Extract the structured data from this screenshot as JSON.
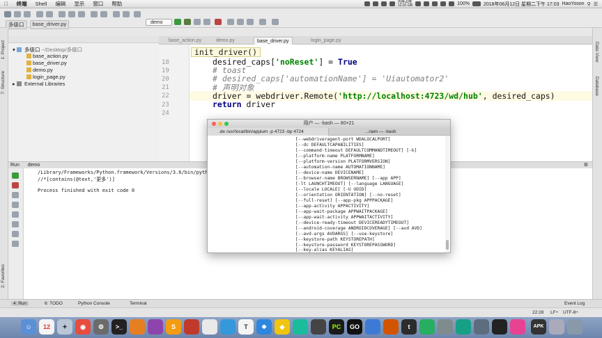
{
  "menubar": {
    "app": "终端",
    "items": [
      "Shell",
      "编辑",
      "显示",
      "窗口",
      "帮助"
    ],
    "status": {
      "memory_line1": "内存占用",
      "memory_line2": "12.01 GB",
      "battery": "100%",
      "datetime": "2018年06月12日 星期二下午 17:03",
      "user": "HaoYoson"
    }
  },
  "ide": {
    "breadcrumb": [
      "多级口",
      "base_driver.py"
    ],
    "run_config": "demo",
    "project_panel": {
      "root": "多级口",
      "root_path": "~/Desktop/多级口",
      "files": [
        "base_action.py",
        "base_driver.py",
        "demo.py",
        "login_page.py"
      ],
      "external": "External Libraries"
    },
    "tabs": [
      "base_action.py",
      "demo.py",
      "base_driver.py",
      "login_page.py"
    ],
    "active_tab": "base_driver.py",
    "function_chip": "init_driver()",
    "line_numbers": [
      "18",
      "19",
      "20",
      "21",
      "22",
      "23",
      "24"
    ],
    "code": {
      "line18_a": "desired_caps[",
      "line18_b": "'noReset'",
      "line18_c": "] = ",
      "line18_d": "True",
      "line19": "# toast",
      "line20": "# desired_caps['automationName'] = 'Uiautomator2'",
      "line21": "# 声明对象",
      "line22_a": "driver = webdriver.Remote(",
      "line22_b": "'http://localhost:4723/wd/hub'",
      "line22_c": ", desired_caps)",
      "line23_a": "return",
      "line23_b": " driver"
    },
    "run_panel": {
      "label_run": "Run",
      "label_cfg": "demo",
      "output_line1": "/Library/Frameworks/Python.framework/Versions/3.6/bin/pyth",
      "output_line2": "//*[contains(@text,'更多')]",
      "output_line3": "Process finished with exit code 0"
    },
    "left_strip": {
      "project": "1: Project",
      "structure": "7: Structure",
      "favorites": "2: Favorites"
    },
    "right_strip": {
      "view": "Data View",
      "database": "Database"
    },
    "bottom_tabs": [
      "4: Run",
      "6: TODO",
      "Python Console",
      "Terminal"
    ],
    "event_log": "Event Log",
    "status": {
      "position": "22:28",
      "line_sep": "LF÷",
      "encoding": "UTF-8÷"
    }
  },
  "terminal": {
    "title": "用户 — -bash — 80×21",
    "tab1": ".de /usr/local/bin/appium -p 4723 -bp 4724",
    "tab2": "...nam — -bash",
    "lines": [
      "[--webdriveragent-port WDALOCALPORT]",
      "[--dc DEFAULTCAPABILITIES]",
      "[--command-timeout DEFAULTCOMMANDTIMEOUT] [-k]",
      "[--platform-name PLATFORMNAME]",
      "[--platform-version PLATFORMVERSION]",
      "[--automation-name AUTOMATIONNAME]",
      "[--device-name DEVICENAME]",
      "[--browser-name BROWSERNAME] [--app APP]",
      "[-lt LAUNCHTIMEOUT] [--language LANGUAGE]",
      "[--locale LOCALE] [-U UDID]",
      "[--orientation ORIENTATION] [--no-reset]",
      "[--full-reset] [--app-pkg APPPACKAGE]",
      "[--app-activity APPACTIVITY]",
      "[--app-wait-package APPWAITPACKAGE]",
      "[--app-wait-activity APPWAITACTIVITY]",
      "[--device-ready-timeout DEVICEREADYTIMEOUT]",
      "[--android-coverage ANDROIDCOVERAGE] [--avd AVD]",
      "[--avd-args AVDARGS] [--use-keystore]",
      "[--keystore-path KEYSTOREPATH]",
      "[--keystore-password KEYSTOREPASSWORD]",
      "[--key-alias KEYALIAS]"
    ]
  },
  "dock": {
    "calendar_day": "12",
    "labels": [
      "T",
      "PC",
      "GO",
      "t",
      "APK"
    ]
  },
  "colors": {
    "keyword": "#000080",
    "string": "#008000",
    "comment": "#808080",
    "current_line": "#fffae3",
    "dock": "#7b93b9"
  }
}
